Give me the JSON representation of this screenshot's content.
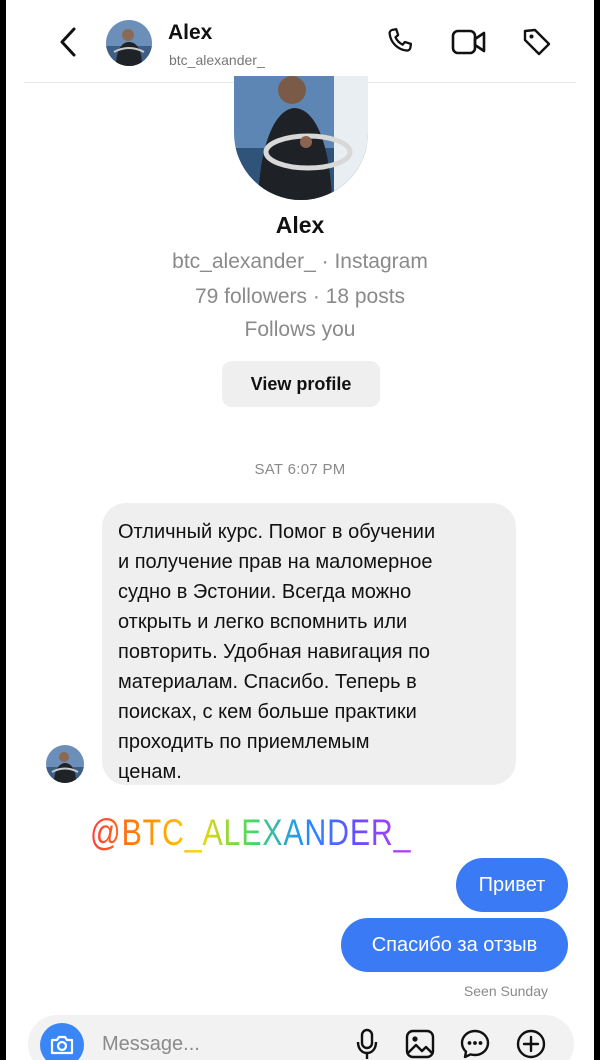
{
  "header": {
    "name": "Alex",
    "username": "btc_alexander_"
  },
  "profile": {
    "name": "Alex",
    "handle_line": "btc_alexander_ · Instagram",
    "stats_line": "79 followers · 18 posts",
    "follows_line": "Follows you",
    "view_profile_label": "View profile"
  },
  "thread": {
    "timestamp": "SAT 6:07 PM",
    "incoming_lines": [
      "Отличный курс. Помог в обучении",
      "и получение прав на маломерное",
      "судно в Эстонии. Всегда можно",
      "открыть и легко вспомнить или",
      "повторить. Удобная навигация по",
      "материалам. Спасибо. Теперь в",
      "поисках, с кем больше практики",
      "проходить по приемлемым",
      "ценам."
    ],
    "sticker_text": "@BTC_ALEXANDER_",
    "outgoing_1": "Привет",
    "outgoing_2": "Спасибо за отзыв",
    "seen_label": "Seen Sunday"
  },
  "composer": {
    "placeholder": "Message..."
  },
  "colors": {
    "outgoing_bubble": "#3a7bf5",
    "incoming_bubble": "#efefef",
    "camera_button": "#3a86f7"
  },
  "icons": [
    "chevron-left-icon",
    "phone-icon",
    "video-camera-icon",
    "tag-icon",
    "camera-icon",
    "microphone-icon",
    "gallery-icon",
    "sticker-chat-icon",
    "plus-circle-icon"
  ]
}
